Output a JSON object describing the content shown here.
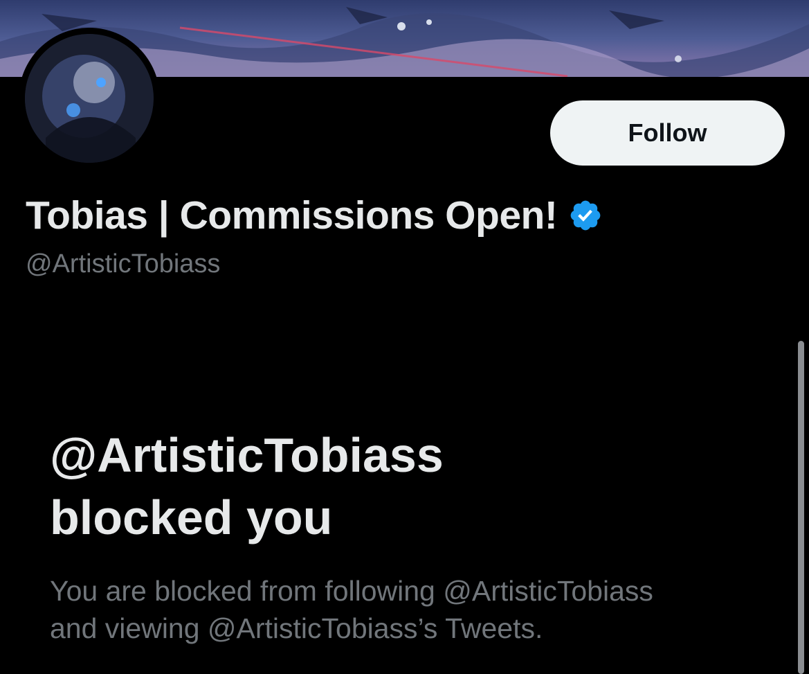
{
  "profile": {
    "display_name": "Tobias | Commissions Open!",
    "handle": "@ArtisticTobiass",
    "verified": true,
    "verified_icon": "verified-badge-icon"
  },
  "actions": {
    "follow_label": "Follow"
  },
  "blocked": {
    "title_line1": "@ArtisticTobiass",
    "title_line2": "blocked you",
    "desc_line1": "You are blocked from following @ArtisticTobiass",
    "desc_line2": "and viewing @ArtisticTobiass’s Tweets."
  },
  "colors": {
    "background": "#000000",
    "primary_text": "#e7e9ea",
    "secondary_text": "#71767b",
    "button_bg": "#eff3f4",
    "button_text": "#0f1419",
    "verified_blue": "#1d9bf0"
  }
}
